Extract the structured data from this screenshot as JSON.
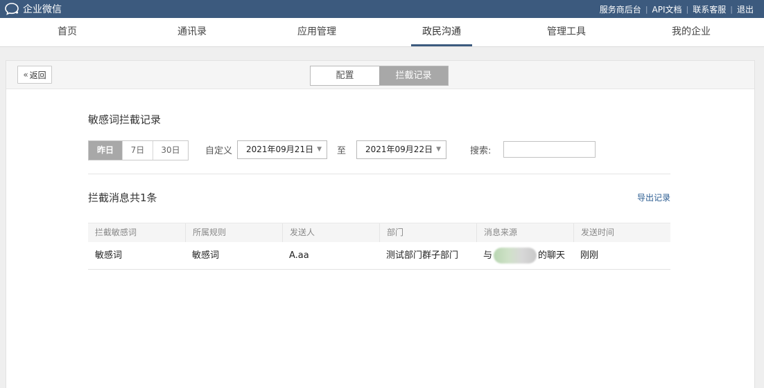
{
  "topbar": {
    "logo_text": "企业微信",
    "links": [
      "服务商后台",
      "API文档",
      "联系客服",
      "退出"
    ]
  },
  "nav": {
    "items": [
      "首页",
      "通讯录",
      "应用管理",
      "政民沟通",
      "管理工具",
      "我的企业"
    ],
    "active": "政民沟通"
  },
  "panel": {
    "back_label": "返回",
    "tabs": [
      "配置",
      "拦截记录"
    ],
    "active_tab": "拦截记录"
  },
  "filter": {
    "section_title": "敏感词拦截记录",
    "ranges": [
      "昨日",
      "7日",
      "30日"
    ],
    "active_range": "昨日",
    "custom_label": "自定义",
    "start_date": "2021年09月21日",
    "to_label": "至",
    "end_date": "2021年09月22日",
    "search_label": "搜索:",
    "search_value": ""
  },
  "results": {
    "count_title": "拦截消息共1条",
    "export_label": "导出记录",
    "columns": [
      "拦截敏感词",
      "所属规则",
      "发送人",
      "部门",
      "消息来源",
      "发送时间"
    ],
    "rows": [
      {
        "word": "敏感词",
        "rule": "敏感词",
        "sender": "A.aa",
        "dept": "测试部门群子部门",
        "source_prefix": "与",
        "source_suffix": "的聊天",
        "time": "刚刚"
      }
    ]
  },
  "colors": {
    "topbar": "#3c5a7e",
    "active_segment": "#a8a8a8",
    "link": "#2b5c91"
  }
}
